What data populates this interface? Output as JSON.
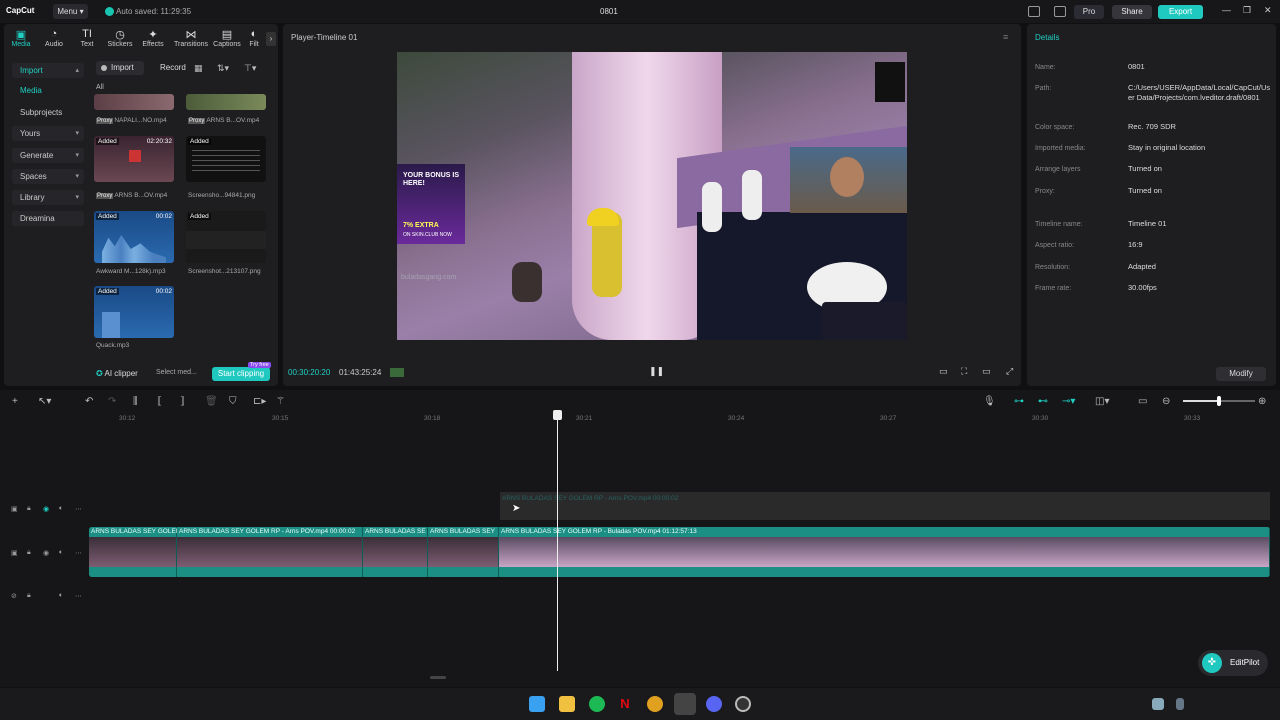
{
  "titlebar": {
    "logo": "CapCut",
    "menu_label": "Menu",
    "autosave": "Auto saved: 11:29:35",
    "project_title": "0801",
    "pro_label": "Pro",
    "share_label": "Share",
    "export_label": "Export"
  },
  "tools": [
    "Media",
    "Audio",
    "Text",
    "Stickers",
    "Effects",
    "Transitions",
    "Captions",
    "Filt"
  ],
  "nav": {
    "import": "Import",
    "media": "Media",
    "subprojects": "Subprojects",
    "yours": "Yours",
    "generate": "Generate",
    "spaces": "Spaces",
    "library": "Library",
    "dreamina": "Dreamina"
  },
  "media_toolbar": {
    "import_label": "Import",
    "record_label": "Record",
    "all_label": "All"
  },
  "media_items": [
    {
      "label": "NAPALI...NO.mp4",
      "badge": "",
      "duration": "",
      "proxy": "Proxy"
    },
    {
      "label": "ARNS B...OV.mp4",
      "badge": "",
      "duration": "",
      "proxy": "Proxy"
    },
    {
      "label": "ARNS B...OV.mp4",
      "badge": "Added",
      "duration": "02:20:32",
      "proxy": "Proxy"
    },
    {
      "label": "Screensho...94841.png",
      "badge": "Added",
      "duration": "",
      "proxy": ""
    },
    {
      "label": "Awkward M...128k).mp3",
      "badge": "Added",
      "duration": "00:02",
      "proxy": ""
    },
    {
      "label": "Screenshot...213107.png",
      "badge": "Added",
      "duration": "",
      "proxy": ""
    },
    {
      "label": "Quack.mp3",
      "badge": "Added",
      "duration": "00:02",
      "proxy": ""
    }
  ],
  "ai_bar": {
    "ai_clipper": "AI clipper",
    "select_media": "Select med...",
    "start_clipping": "Start clipping",
    "try_free": "Try free"
  },
  "player": {
    "title": "Player-Timeline 01",
    "current_time": "00:30:20:20",
    "total_time": "01:43:25:24",
    "video_overlay": {
      "bonus": "YOUR BONUS IS HERE!",
      "extra": "7% EXTRA",
      "site": "ON SKIN.CLUB NOW",
      "watermark": "buladasgang.com"
    }
  },
  "details": {
    "title": "Details",
    "rows": [
      {
        "key": "Name:",
        "value": "0801"
      },
      {
        "key": "Path:",
        "value": "C:/Users/USER/AppData/Local/CapCut/User Data/Projects/com.lveditor.draft/0801"
      },
      {
        "key": "Color space:",
        "value": "Rec. 709 SDR"
      },
      {
        "key": "Imported media:",
        "value": "Stay in original location"
      },
      {
        "key": "Arrange layers",
        "value": "Turned on"
      },
      {
        "key": "Proxy:",
        "value": "Turned on"
      },
      {
        "key": "Timeline name:",
        "value": "Timeline 01"
      },
      {
        "key": "Aspect ratio:",
        "value": "16:9"
      },
      {
        "key": "Resolution:",
        "value": "Adapted"
      },
      {
        "key": "Frame rate:",
        "value": "30.00fps"
      }
    ],
    "modify_label": "Modify"
  },
  "ruler_ticks": [
    "30:12",
    "30:15",
    "30:18",
    "30:21",
    "30:24",
    "30:27",
    "30:30",
    "30:33"
  ],
  "clips": [
    {
      "label": "ARNS BULADAS SEY GOLEM I"
    },
    {
      "label": "ARNS BULADAS SEY GOLEM RP - Arns POV.mp4   00:00:02"
    },
    {
      "label": "ARNS BULADAS SE"
    },
    {
      "label": "ARNS BULADAS SEY"
    },
    {
      "label": "ARNS BULADAS SEY GOLEM RP - Buladas POV.mp4   01:12:57:13"
    }
  ],
  "ghost_clip_label": "ARNS BULADAS SEY GOLEM RP - Arns POV.mp4   00:00:02",
  "editpilot_label": "EditPilot",
  "colors": {
    "accent": "#1fc9bf",
    "track": "#1c8f85",
    "panel": "#1e1e21"
  }
}
